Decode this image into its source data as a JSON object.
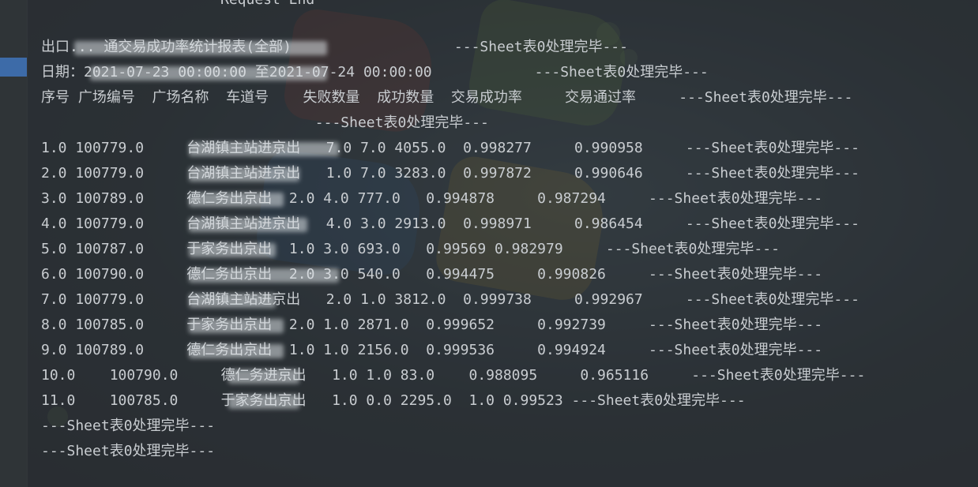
{
  "console": {
    "top_line": "Request End",
    "lines": [
      "出口... 通交易成功率统计报表(全部)                   ---Sheet表0处理完毕---",
      "日期：2021-07-23 00:00:00 至2021-07-24 00:00:00            ---Sheet表0处理完毕---",
      "序号 广场编号  广场名称  车道号    失败数量  成功数量  交易成功率     交易通过率     ---Sheet表0处理完毕---",
      "                                ---Sheet表0处理完毕---",
      "1.0 100779.0     台湖镇主站进京出   7.0 7.0 4055.0  0.998277     0.990958     ---Sheet表0处理完毕---",
      "2.0 100779.0     台湖镇主站进京出   1.0 7.0 3283.0  0.997872     0.990646     ---Sheet表0处理完毕---",
      "3.0 100789.0     德仁务出京出  2.0 4.0 777.0   0.994878     0.987294     ---Sheet表0处理完毕---",
      "4.0 100779.0     台湖镇主站进京出   4.0 3.0 2913.0  0.998971     0.986454     ---Sheet表0处理完毕---",
      "5.0 100787.0     于家务出京出  1.0 3.0 693.0   0.99569 0.982979     ---Sheet表0处理完毕---",
      "6.0 100790.0     德仁务出京出  2.0 3.0 540.0   0.994475     0.990826     ---Sheet表0处理完毕---",
      "7.0 100779.0     台湖镇主站进京出   2.0 1.0 3812.0  0.999738     0.992967     ---Sheet表0处理完毕---",
      "8.0 100785.0     于家务出京出  2.0 1.0 2871.0  0.999652     0.992739     ---Sheet表0处理完毕---",
      "9.0 100789.0     德仁务出京出  1.0 1.0 2156.0  0.999536     0.994924     ---Sheet表0处理完毕---",
      "10.0    100790.0     德仁务进京出   1.0 1.0 83.0    0.988095     0.965116     ---Sheet表0处理完毕---",
      "11.0    100785.0     于家务出京出   1.0 0.0 2295.0  1.0 0.99523 ---Sheet表0处理完毕---",
      "---Sheet表0处理完毕---",
      "---Sheet表0处理完毕---"
    ]
  }
}
